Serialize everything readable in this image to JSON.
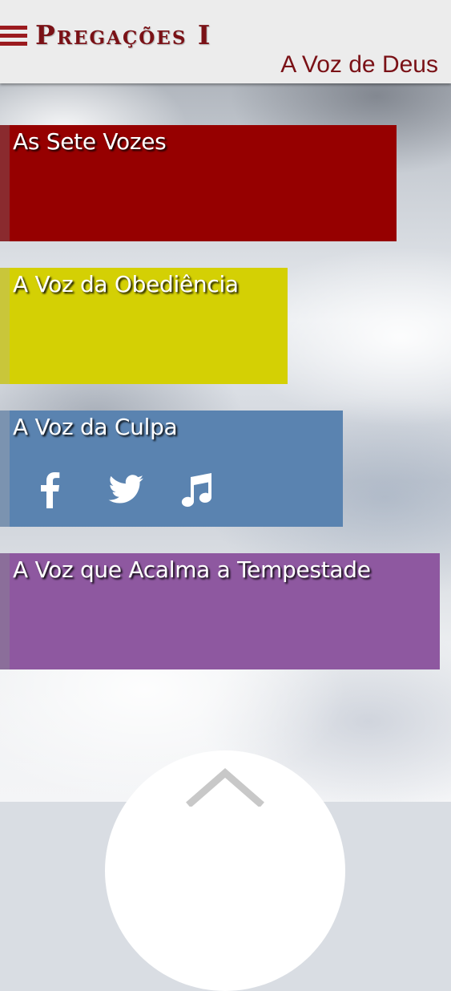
{
  "header": {
    "title": "Pregações I",
    "subtitle": "A Voz de Deus",
    "menu_icon": "hamburger-menu-icon"
  },
  "colors": {
    "brand": "#7a1116",
    "tile_red": "#960000",
    "tile_yellow": "#d4d004",
    "tile_blue": "#5a83b0",
    "tile_purple": "#8e58a0"
  },
  "tiles": [
    {
      "title": "As Sete Vozes"
    },
    {
      "title": "A Voz da Obediência"
    },
    {
      "title": "A Voz da Culpa",
      "icons": [
        "facebook-icon",
        "twitter-icon",
        "music-note-icon"
      ]
    },
    {
      "title": "A Voz que Acalma a Tempestade"
    }
  ],
  "footer": {
    "up_icon": "chevron-up-icon"
  }
}
